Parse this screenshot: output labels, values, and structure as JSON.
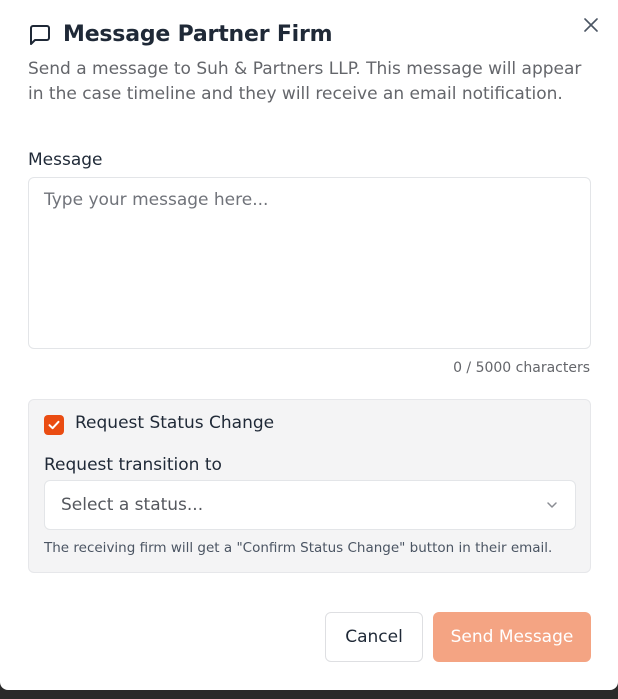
{
  "dialog": {
    "title": "Message Partner Firm",
    "title_icon": "message-square-icon",
    "close_icon": "close-icon",
    "description": "Send a message to Suh & Partners LLP. This message will appear in the case timeline and they will receive an email notification."
  },
  "message": {
    "label": "Message",
    "value": "",
    "placeholder": "Type your message here...",
    "char_count": "0 / 5000 characters"
  },
  "status_change": {
    "checkbox_label": "Request Status Change",
    "checked": true,
    "transition_label": "Request transition to",
    "select_placeholder": "Select a status...",
    "helper_text": "The receiving firm will get a \"Confirm Status Change\" button in their email."
  },
  "actions": {
    "cancel_label": "Cancel",
    "send_label": "Send Message"
  },
  "colors": {
    "accent": "#ea4c12",
    "send_button_disabled": "#f4a483",
    "panel_bg": "#f4f4f5"
  }
}
